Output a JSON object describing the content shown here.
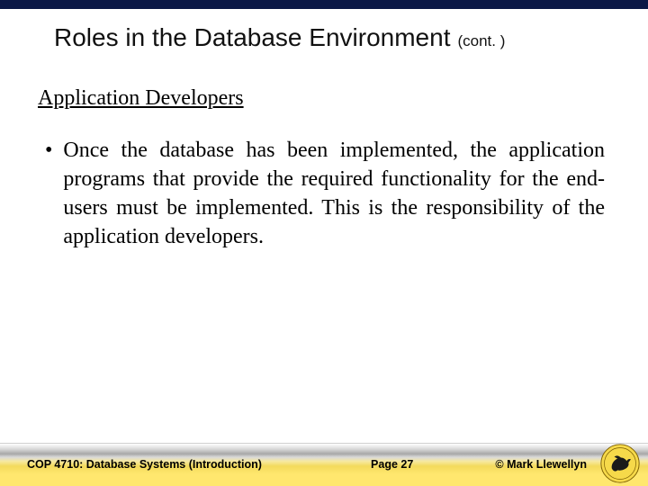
{
  "header": {
    "title": "Roles in the Database Environment",
    "cont": "(cont. )"
  },
  "subheading": "Application Developers",
  "bullets": [
    "Once the database has been implemented, the application programs that provide the required functionality for the end-users must be implemented.  This is the responsibility of the application developers."
  ],
  "footer": {
    "course": "COP 4710: Database Systems  (Introduction)",
    "page": "Page 27",
    "copyright": "© Mark Llewellyn"
  },
  "colors": {
    "topbar": "#0b1846",
    "gold": "#f3da5c"
  }
}
